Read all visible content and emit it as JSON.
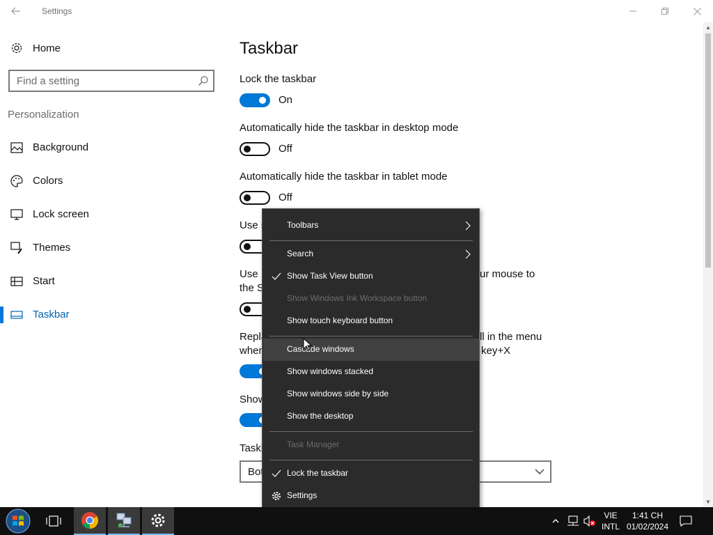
{
  "window": {
    "title": "Settings",
    "back_icon": "back-arrow-icon",
    "min_icon": "minimize-icon",
    "max_icon": "restore-icon",
    "close_icon": "close-icon"
  },
  "sidebar": {
    "home_label": "Home",
    "search_placeholder": "Find a setting",
    "section_title": "Personalization",
    "items": [
      {
        "label": "Background",
        "icon": "picture-icon"
      },
      {
        "label": "Colors",
        "icon": "palette-icon"
      },
      {
        "label": "Lock screen",
        "icon": "monitor-icon"
      },
      {
        "label": "Themes",
        "icon": "brush-icon"
      },
      {
        "label": "Start",
        "icon": "start-grid-icon"
      },
      {
        "label": "Taskbar",
        "icon": "taskbar-icon",
        "active": true
      }
    ]
  },
  "main": {
    "title": "Taskbar",
    "settings": [
      {
        "label": "Lock the taskbar",
        "state": "On"
      },
      {
        "label": "Automatically hide the taskbar in desktop mode",
        "state": "Off"
      },
      {
        "label": "Automatically hide the taskbar in tablet mode",
        "state": "Off"
      }
    ],
    "partial_lines": {
      "l1": "Use s",
      "l2a": "Use P",
      "l2a_tail": "ur mouse to",
      "l2b": "the S",
      "l3a": "Repla",
      "l3a_tail": "ll in the menu",
      "l3b": "when",
      "l3b_tail": "key+X",
      "l4": "Show",
      "l5": "Taskb"
    },
    "dropdown_value": "Bot"
  },
  "context_menu": {
    "items": [
      {
        "label": "Toolbars",
        "submenu": true
      },
      {
        "label": "Search",
        "submenu": true
      },
      {
        "label": "Show Task View button",
        "checked": true
      },
      {
        "label": "Show Windows Ink Workspace button",
        "disabled": true
      },
      {
        "label": "Show touch keyboard button"
      },
      {
        "label": "Cascade windows"
      },
      {
        "label": "Show windows stacked"
      },
      {
        "label": "Show windows side by side"
      },
      {
        "label": "Show the desktop"
      },
      {
        "label": "Task Manager",
        "disabled": true
      },
      {
        "label": "Lock the taskbar",
        "checked": true
      },
      {
        "label": "Settings",
        "icon": "gear-icon"
      }
    ]
  },
  "taskbar": {
    "apps": [
      "start-orb-icon",
      "task-view-icon",
      "chrome-icon",
      "network-app-icon",
      "settings-gear-icon"
    ],
    "tray": {
      "lang_line1": "VIE",
      "lang_line2": "INTL",
      "time": "1:41 CH",
      "date": "01/02/2024"
    }
  },
  "colors": {
    "accent": "#0078d7",
    "menu_bg": "#2b2b2b",
    "taskbar_bg": "#101010"
  }
}
